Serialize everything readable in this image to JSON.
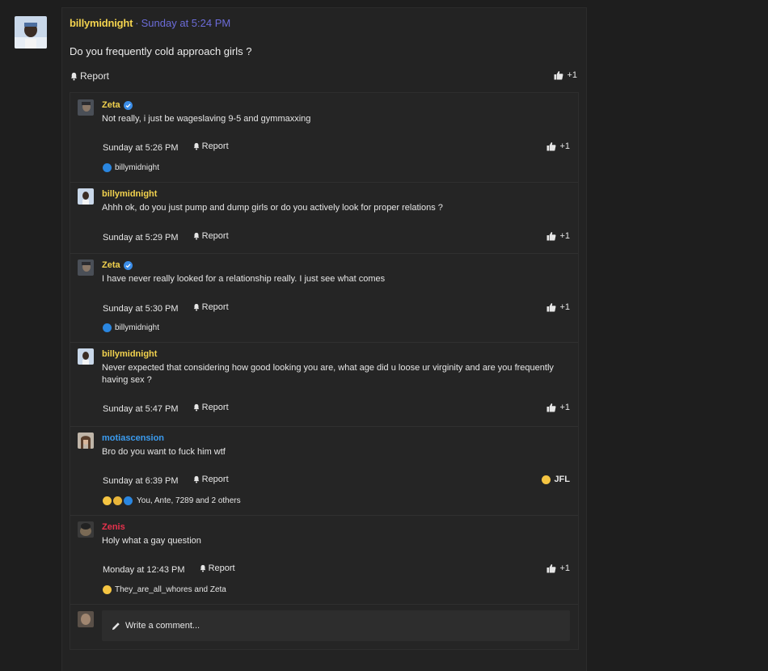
{
  "post": {
    "author": "billymidnight",
    "separator": "·",
    "time": "Sunday at 5:24 PM",
    "body": "Do you frequently cold approach girls ?",
    "report_label": "Report",
    "like_label": "+1"
  },
  "comments": [
    {
      "author": "Zeta",
      "author_color": "#f2d24e",
      "verified": true,
      "text": "Not really, i just be wageslaving 9-5 and gymmaxxing",
      "time": "Sunday at 5:26 PM",
      "report_label": "Report",
      "like_label": "+1",
      "reactions": "billymidnight"
    },
    {
      "author": "billymidnight",
      "author_color": "#f2d24e",
      "verified": false,
      "text": "Ahhh ok, do you just pump and dump girls or do you actively look for proper relations ?",
      "time": "Sunday at 5:29 PM",
      "report_label": "Report",
      "like_label": "+1"
    },
    {
      "author": "Zeta",
      "author_color": "#f2d24e",
      "verified": true,
      "text": "I have never really looked for a relationship really. I just see what comes",
      "time": "Sunday at 5:30 PM",
      "report_label": "Report",
      "like_label": "+1",
      "reactions": "billymidnight"
    },
    {
      "author": "billymidnight",
      "author_color": "#f2d24e",
      "verified": false,
      "text": "Never expected that considering how good looking you are, what age did u loose ur virginity and are you frequently having sex ?",
      "time": "Sunday at 5:47 PM",
      "report_label": "Report",
      "like_label": "+1"
    },
    {
      "author": "motiascension",
      "author_color": "#3b9cf0",
      "verified": false,
      "text": "Bro do you want to fuck him wtf",
      "time": "Sunday at 6:39 PM",
      "report_label": "Report",
      "like_label": "JFL",
      "reactions": "You, Ante, 7289 and 2 others"
    },
    {
      "author": "Zenis",
      "author_color": "#e8324d",
      "verified": false,
      "text": "Holy what a gay question",
      "time": "Monday at 12:43 PM",
      "report_label": "Report",
      "like_label": "+1",
      "reactions": "They_are_all_whores and Zeta"
    }
  ],
  "write_comment": {
    "placeholder": "Write a comment..."
  },
  "colors": {
    "accent_blue": "#6c6cd9",
    "username_yellow": "#f2d24e",
    "like_blue": "#2a86e0"
  }
}
